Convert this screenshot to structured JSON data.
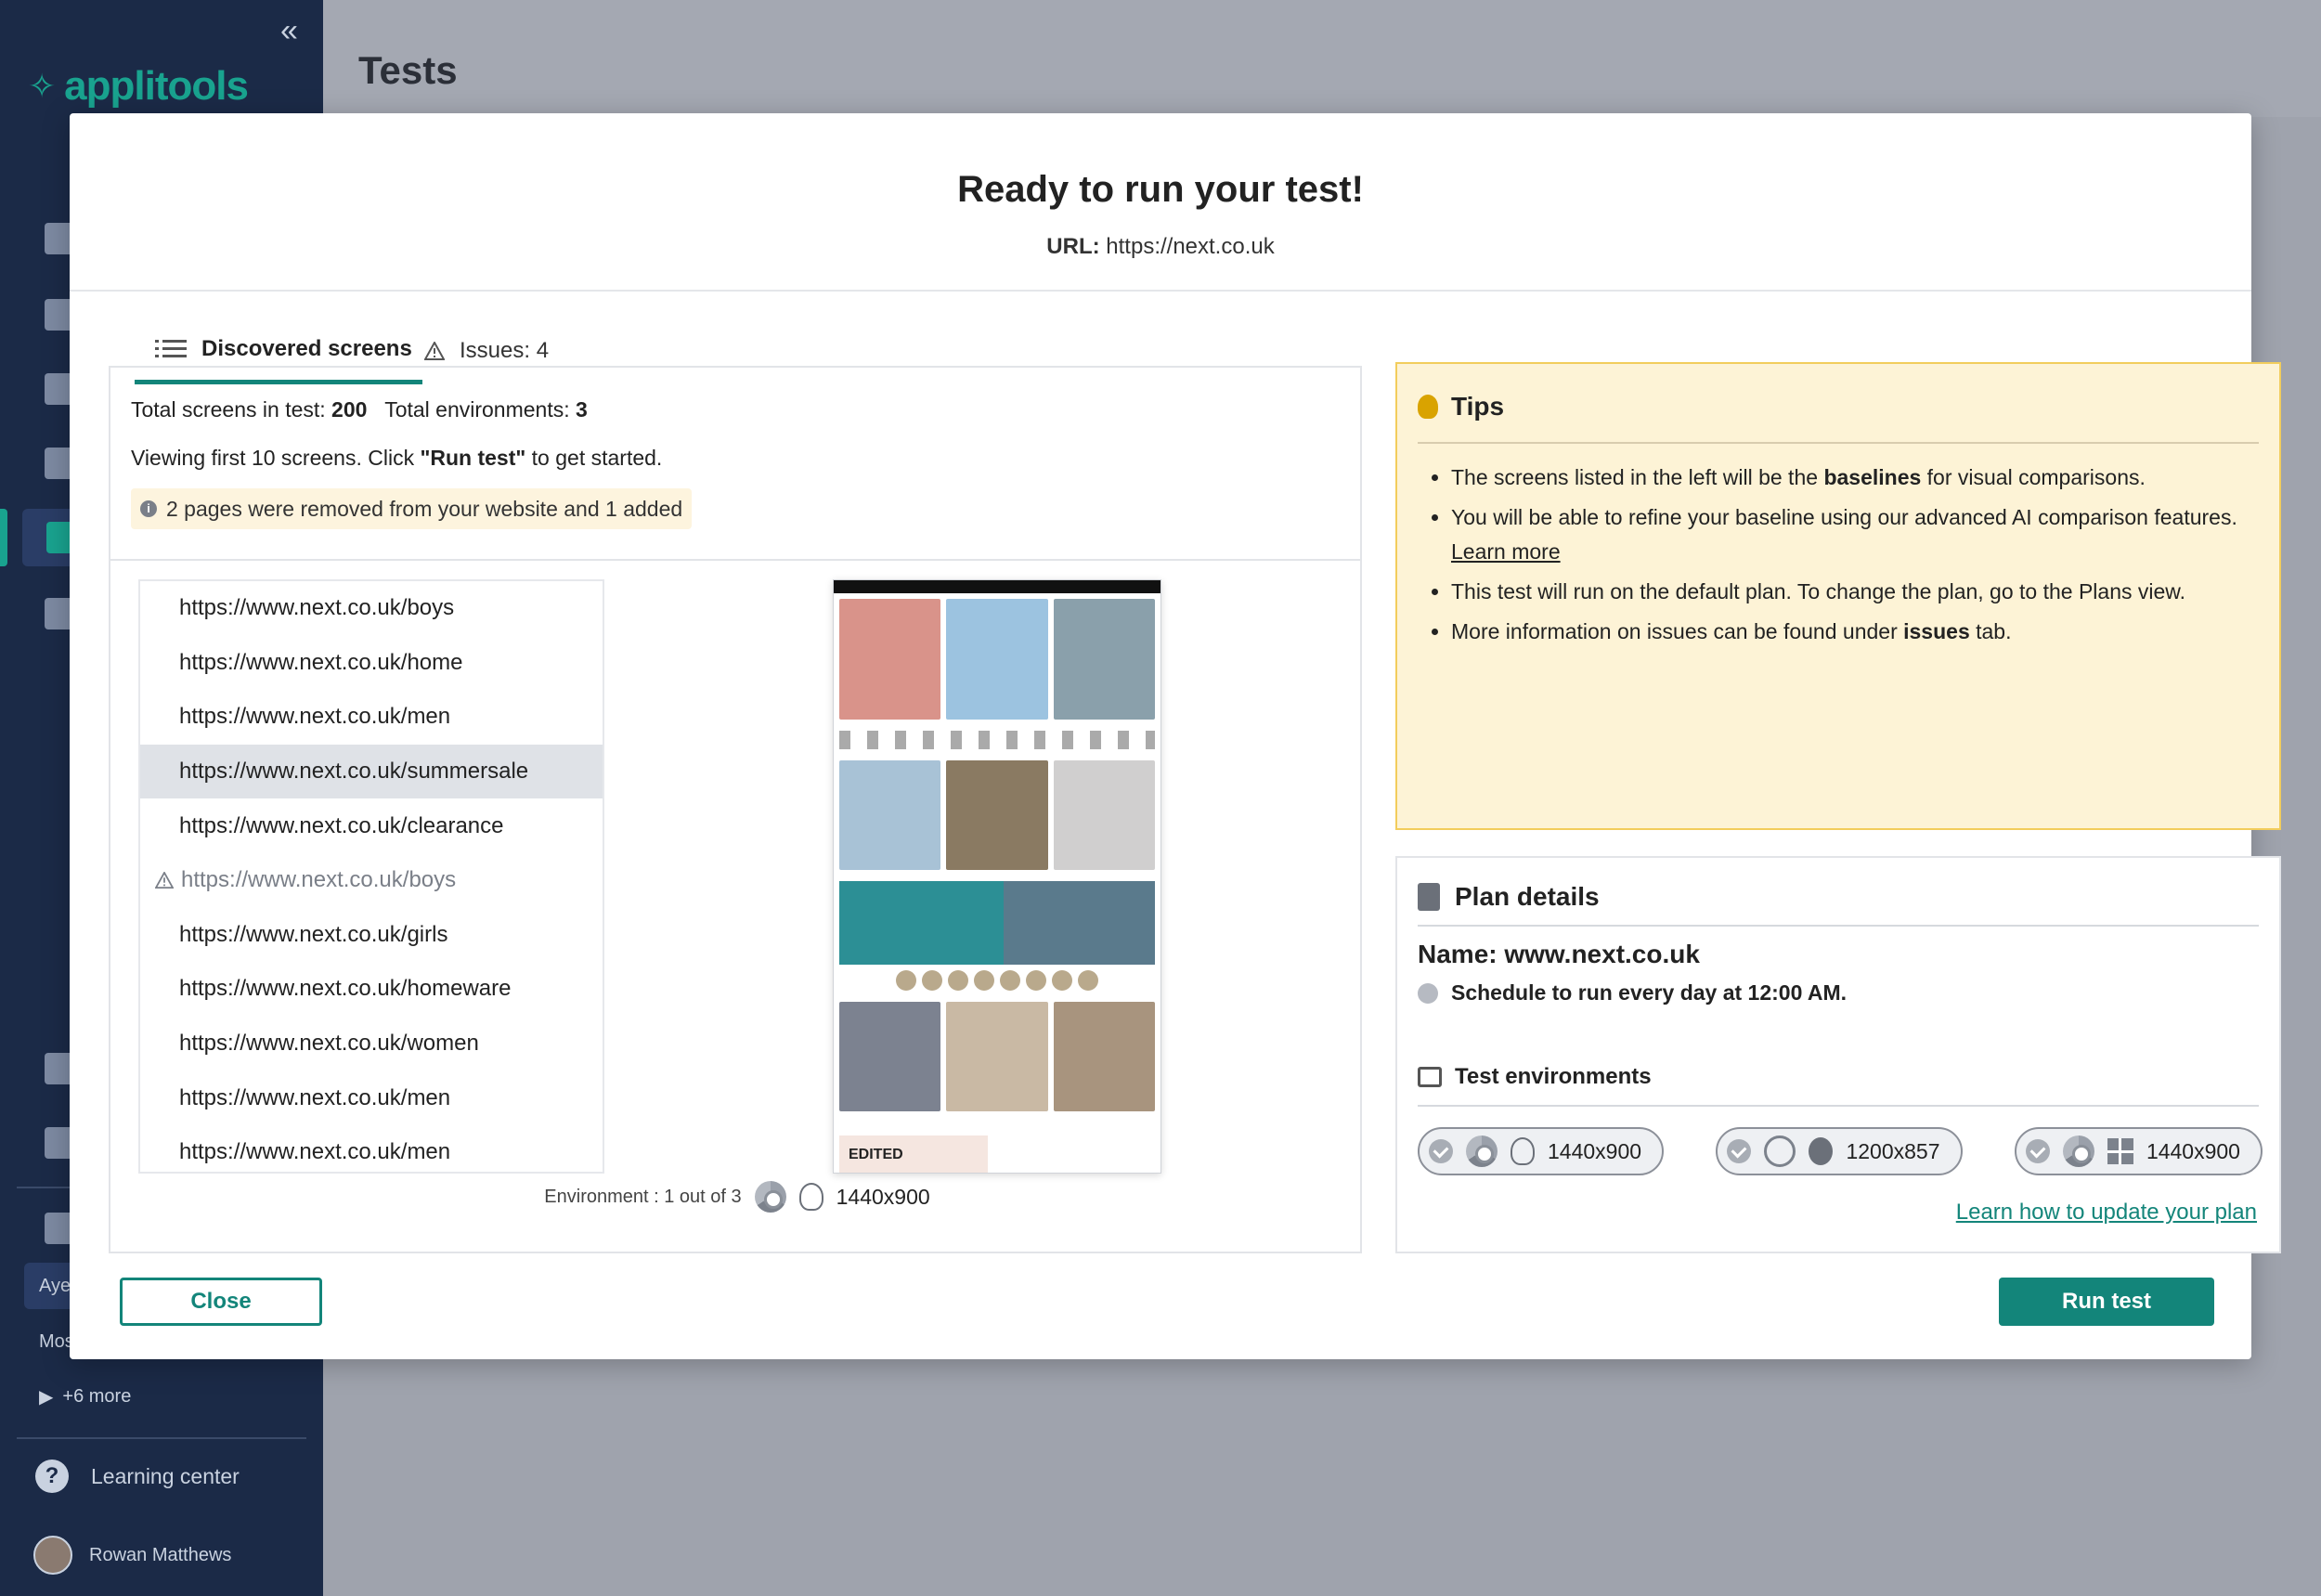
{
  "sidebar": {
    "logo": "applitools",
    "more_label": "+6 more",
    "ayc_label": "Aye",
    "mos_label": "Mos",
    "learning_center": "Learning center",
    "user_name": "Rowan Matthews"
  },
  "page": {
    "title": "Tests"
  },
  "modal": {
    "title": "Ready to run your test!",
    "url_label": "URL:",
    "url_value": "https://next.co.uk",
    "tabs": [
      {
        "label": "Discovered screens"
      },
      {
        "label": "Issues: 4"
      }
    ],
    "summary": {
      "total_screens_label": "Total screens in test:",
      "total_screens_value": "200",
      "total_envs_label": "Total environments:",
      "total_envs_value": "3",
      "viewing_prefix": "Viewing first 10 screens. Click",
      "viewing_bold": "\"Run test\"",
      "viewing_suffix": "to get started.",
      "notice": "2 pages were removed from your website and 1 added"
    },
    "urls": [
      "https://www.next.co.uk/boys",
      "https://www.next.co.uk/home",
      "https://www.next.co.uk/men",
      "https://www.next.co.uk/summersale",
      "https://www.next.co.uk/clearance",
      "https://www.next.co.uk/boys",
      "https://www.next.co.uk/girls",
      "https://www.next.co.uk/homeware",
      "https://www.next.co.uk/women",
      "https://www.next.co.uk/men",
      "https://www.next.co.uk/men"
    ],
    "preview": {
      "edited_label": "EDITED",
      "env_label": "Environment : 1 out of 3",
      "env_resolution": "1440x900"
    },
    "tips": {
      "title": "Tips",
      "items": [
        {
          "pre": "The screens listed in the left will be the",
          "bold": "baselines",
          "post": "for visual comparisons."
        },
        {
          "pre": "You will be able to refine your baseline using our advanced AI comparison features.",
          "link": "Learn more"
        },
        {
          "pre": "This test will run on the default plan. To change the plan, go to the Plans view."
        },
        {
          "pre": "More information on issues can be found under",
          "bold": "issues",
          "post": "tab."
        }
      ]
    },
    "plan": {
      "title": "Plan details",
      "name": "Name: www.next.co.uk",
      "schedule": "Schedule to run every day at 12:00 AM.",
      "envs_title": "Test environments",
      "envs": [
        {
          "browser": "chrome-icon",
          "os": "linux-icon",
          "resolution": "1440x900"
        },
        {
          "browser": "safari-icon",
          "os": "apple-icon",
          "resolution": "1200x857"
        },
        {
          "browser": "chrome-icon",
          "os": "windows-icon",
          "resolution": "1440x900"
        }
      ],
      "update_link": "Learn how to update your plan"
    },
    "buttons": {
      "close": "Close",
      "run": "Run test"
    }
  },
  "colors": {
    "accent": "#13857a",
    "sidebar": "#1b2a47",
    "tips_bg": "#fdf3d6",
    "tips_border": "#f2cd5c"
  }
}
